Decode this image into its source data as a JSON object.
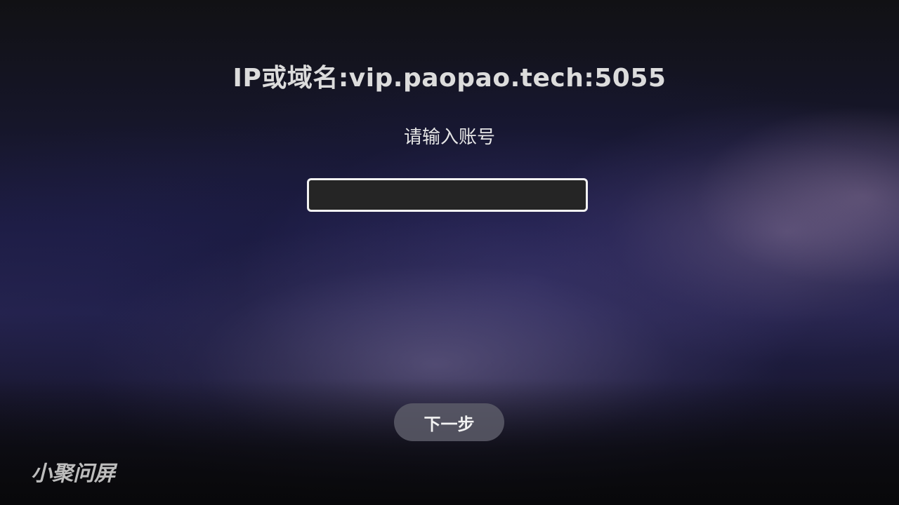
{
  "server": {
    "label": "IP或域名:vip.paopao.tech:5055"
  },
  "login": {
    "prompt": "请输入账号",
    "account_value": "",
    "next_label": "下一步"
  },
  "branding": {
    "watermark": "小聚问屏"
  },
  "colors": {
    "input_border": "#f2f2f2",
    "input_background": "#252525",
    "button_background": "#5c5c68"
  }
}
